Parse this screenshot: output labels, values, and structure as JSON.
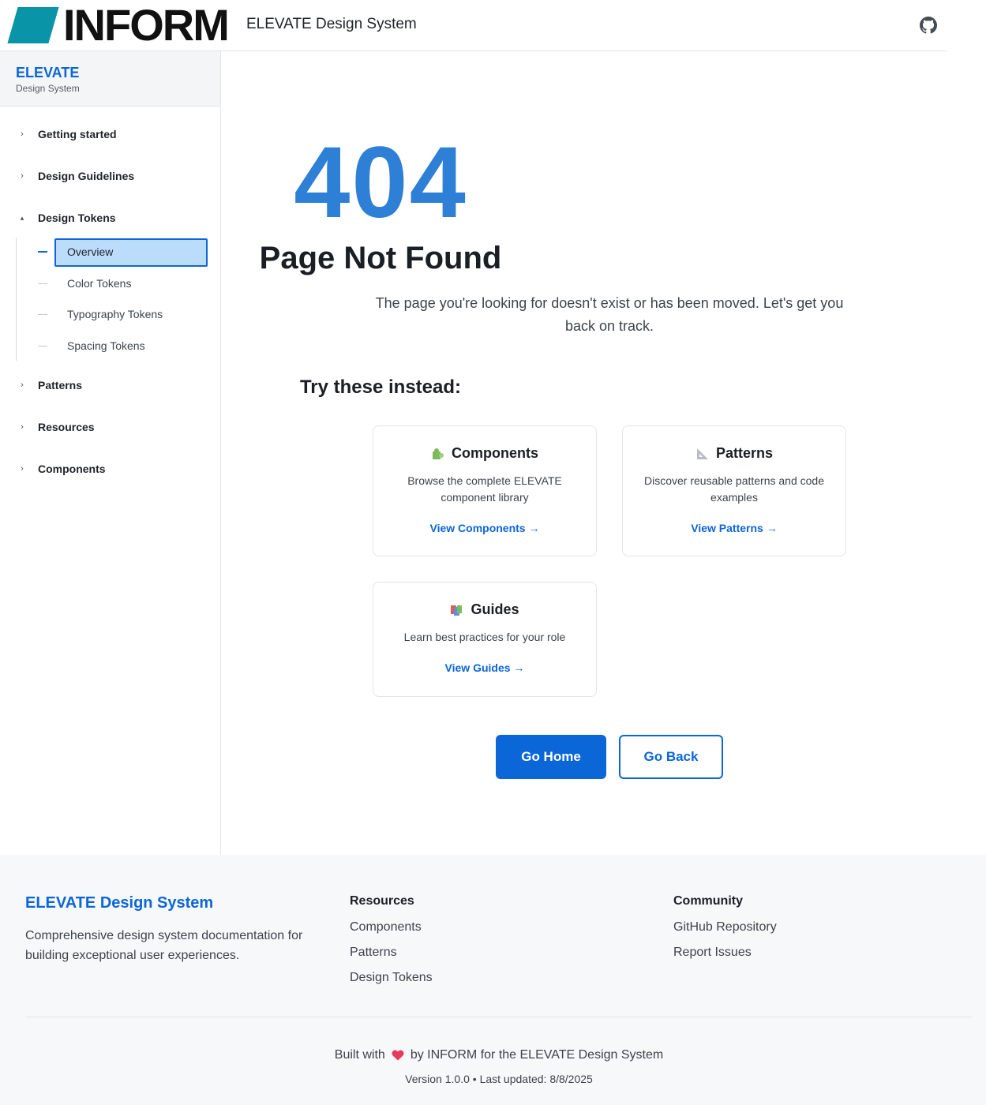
{
  "header": {
    "logo_text": "INFORM",
    "site_title": "ELEVATE Design System",
    "github_icon": "github-icon"
  },
  "sidebar": {
    "title": "ELEVATE",
    "subtitle": "Design System",
    "items": [
      {
        "label": "Getting started",
        "expanded": false
      },
      {
        "label": "Design Guidelines",
        "expanded": false
      },
      {
        "label": "Design Tokens",
        "expanded": true
      },
      {
        "label": "Patterns",
        "expanded": false
      },
      {
        "label": "Resources",
        "expanded": false
      },
      {
        "label": "Components",
        "expanded": false
      }
    ],
    "subitems": [
      {
        "label": "Overview",
        "active": true
      },
      {
        "label": "Color Tokens",
        "active": false
      },
      {
        "label": "Typography Tokens",
        "active": false
      },
      {
        "label": "Spacing Tokens",
        "active": false
      }
    ]
  },
  "main": {
    "code": "404",
    "title": "Page Not Found",
    "description": "The page you're looking for doesn't exist or has been moved. Let's get you back on track.",
    "suggest_title": "Try these instead:",
    "cards": [
      {
        "icon": "puzzle-piece-icon",
        "title": "Components",
        "description": "Browse the complete ELEVATE component library",
        "link": "View Components →"
      },
      {
        "icon": "triangular-ruler-icon",
        "title": "Patterns",
        "description": "Discover reusable patterns and code examples",
        "link": "View Patterns →"
      },
      {
        "icon": "books-icon",
        "title": "Guides",
        "description": "Learn best practices for your role",
        "link": "View Guides →"
      }
    ],
    "home_button": "Go Home",
    "back_button": "Go Back"
  },
  "footer": {
    "brand": "ELEVATE Design System",
    "description": "Comprehensive design system documentation for building exceptional user experiences.",
    "resources_heading": "Resources",
    "resources": [
      "Components",
      "Patterns",
      "Design Tokens"
    ],
    "community_heading": "Community",
    "community": [
      "GitHub Repository",
      "Report Issues"
    ],
    "built_prefix": "Built with",
    "built_suffix": "by INFORM for the ELEVATE Design System",
    "version": "Version 1.0.0 • Last updated: 8/8/2025"
  },
  "colors": {
    "primary": "#0b66d8",
    "accent_404": "#2e7fd6",
    "logo_mark": "#0a94a8",
    "active_bg": "#bcdcfc"
  }
}
